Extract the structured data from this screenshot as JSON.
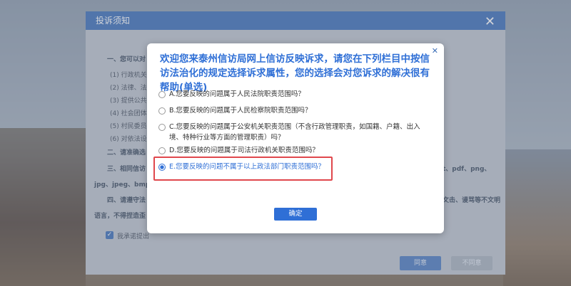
{
  "background_modal": {
    "title": "投诉须知",
    "lines": [
      "一、您可以对",
      "(1) 行政机关",
      "(2) 法律、法规",
      "(3) 提供公共",
      "(4) 社会团体",
      "(5) 村民委员会",
      "(6) 对依法设",
      "二、请准确选",
      "三、相同信访",
      "t、pdf、png、",
      "jpg、jpeg、bmp、",
      "四、请遵守法",
      "文击、谩骂等不文明",
      "语言，不得捏造歪",
      "我承诺提出"
    ],
    "agree_button": "同意",
    "disagree_button": "不同意"
  },
  "dialog": {
    "title": "欢迎您来泰州信访局网上信访反映诉求，请您在下列栏目中按信访法治化的规定选择诉求属性，您的选择会对您诉求的解决很有帮助(单选)",
    "options": [
      {
        "label": "A.您要反映的问题属于人民法院职责范围吗？",
        "selected": false
      },
      {
        "label": "B.您要反映的问题属于人民检察院职责范围吗？",
        "selected": false
      },
      {
        "label": "C.您要反映的问题属于公安机关职责范围（不含行政管理职责，如国籍、户籍、出入境、特种行业等方面的管理职责）吗？",
        "selected": false
      },
      {
        "label": "D.您要反映的问题属于司法行政机关职责范围吗？",
        "selected": false
      },
      {
        "label": "E.您要反映的问题不属于以上政法部门职责范围吗？",
        "selected": true
      }
    ],
    "confirm_button": "确定"
  },
  "colors": {
    "accent": "#2f6fd6",
    "header": "#3d6fb8",
    "highlight_border": "#e0474c"
  }
}
